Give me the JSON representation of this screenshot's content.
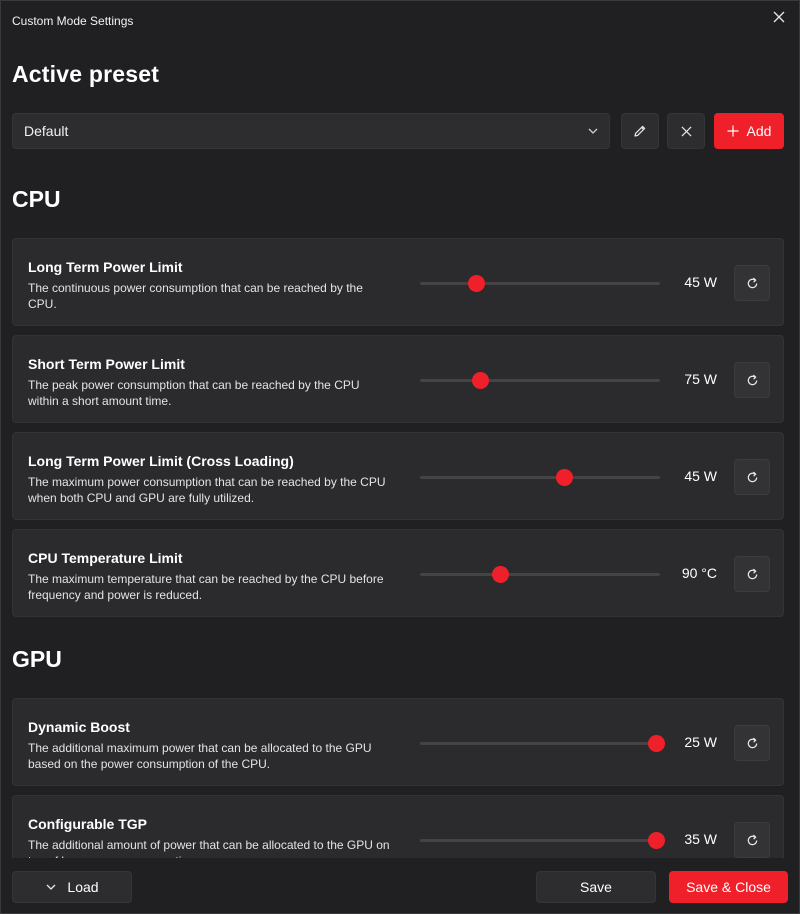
{
  "window": {
    "title": "Custom Mode Settings"
  },
  "preset": {
    "heading": "Active preset",
    "selected": "Default",
    "add_label": "Add"
  },
  "cpu": {
    "heading": "CPU",
    "settings": [
      {
        "title": "Long Term Power Limit",
        "description": "The continuous power consumption that can be reached by the CPU.",
        "value": "45 W",
        "level": 0.25
      },
      {
        "title": "Short Term Power Limit",
        "description": "The peak power consumption that can be reached by the CPU within a short amount time.",
        "value": "75 W",
        "level": 0.27
      },
      {
        "title": "Long Term Power Limit (Cross Loading)",
        "description": "The maximum power consumption that can be reached by the CPU when both CPU and GPU are fully utilized.",
        "value": "45 W",
        "level": 0.62
      },
      {
        "title": "CPU Temperature Limit",
        "description": "The maximum temperature that can be reached by the CPU before frequency and power is reduced.",
        "value": "90 °C",
        "level": 0.35
      }
    ]
  },
  "gpu": {
    "heading": "GPU",
    "settings": [
      {
        "title": "Dynamic Boost",
        "description": "The additional maximum power that can be allocated to the GPU based on the power consumption of the CPU.",
        "value": "25 W",
        "level": 1.0
      },
      {
        "title": "Configurable TGP",
        "description": "The additional amount of power that can be allocated to the GPU on top of base power consumption.",
        "value": "35 W",
        "level": 1.0
      }
    ]
  },
  "footer": {
    "load_label": "Load",
    "save_label": "Save",
    "save_close_label": "Save & Close"
  },
  "colors": {
    "accent": "#f0202a",
    "background": "#202023",
    "card": "#2b2b2e"
  }
}
